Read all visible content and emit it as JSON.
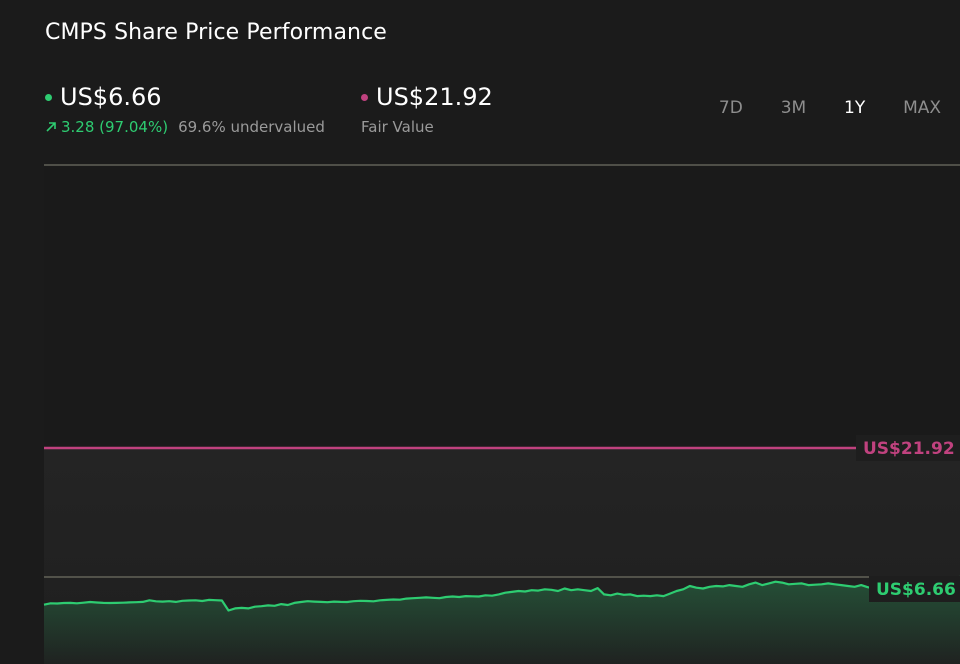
{
  "header": {
    "title": "CMPS Share Price Performance"
  },
  "price": {
    "value": "US$6.66",
    "change": "3.28 (97.04%)",
    "valuation": "69.6% undervalued",
    "color": "#2ecc71"
  },
  "fair_value": {
    "value": "US$21.92",
    "label": "Fair Value",
    "color": "#c0427f"
  },
  "periods": [
    {
      "label": "7D",
      "active": false
    },
    {
      "label": "3M",
      "active": false
    },
    {
      "label": "1Y",
      "active": true
    },
    {
      "label": "MAX",
      "active": false
    }
  ],
  "chart_data": {
    "type": "line",
    "series": [
      {
        "values": [
          3.38,
          3.55,
          3.52,
          3.58,
          3.6,
          3.55,
          3.62,
          3.7,
          3.64,
          3.6,
          3.58,
          3.6,
          3.62,
          3.65,
          3.68,
          3.72,
          3.9,
          3.78,
          3.75,
          3.8,
          3.72,
          3.85,
          3.88,
          3.9,
          3.82,
          3.95,
          3.92,
          3.88,
          2.7,
          2.95,
          3.0,
          2.95,
          3.15,
          3.2,
          3.3,
          3.25,
          3.45,
          3.35,
          3.6,
          3.7,
          3.8,
          3.75,
          3.72,
          3.68,
          3.75,
          3.72,
          3.7,
          3.8,
          3.85,
          3.82,
          3.78,
          3.9,
          3.95,
          4.0,
          3.98,
          4.1,
          4.15,
          4.2,
          4.25,
          4.2,
          4.15,
          4.3,
          4.35,
          4.3,
          4.4,
          4.38,
          4.35,
          4.5,
          4.45,
          4.6,
          4.8,
          4.9,
          5.0,
          4.95,
          5.1,
          5.05,
          5.2,
          5.15,
          5.0,
          5.3,
          5.1,
          5.2,
          5.1,
          5.0,
          5.35,
          4.6,
          4.5,
          4.7,
          4.55,
          4.6,
          4.4,
          4.45,
          4.4,
          4.5,
          4.4,
          4.7,
          5.0,
          5.2,
          5.6,
          5.4,
          5.3,
          5.5,
          5.6,
          5.55,
          5.7,
          5.6,
          5.5,
          5.8,
          6.0,
          5.7,
          5.9,
          6.1,
          6.0,
          5.8,
          5.85,
          5.9,
          5.7,
          5.75,
          5.8,
          5.9,
          5.8,
          5.7,
          5.6,
          5.5,
          5.7,
          5.45,
          5.3,
          5.85,
          6.4,
          6.6,
          6.3,
          6.45,
          6.0,
          5.9,
          6.05,
          6.2,
          6.1,
          6.3,
          6.55,
          6.66
        ]
      }
    ],
    "reference_lines": [
      {
        "label": "US$21.92",
        "value": 21.92,
        "color": "#c0427f"
      },
      {
        "label": "US$6.66",
        "value": 6.66,
        "color": "#2ecc71"
      }
    ]
  }
}
